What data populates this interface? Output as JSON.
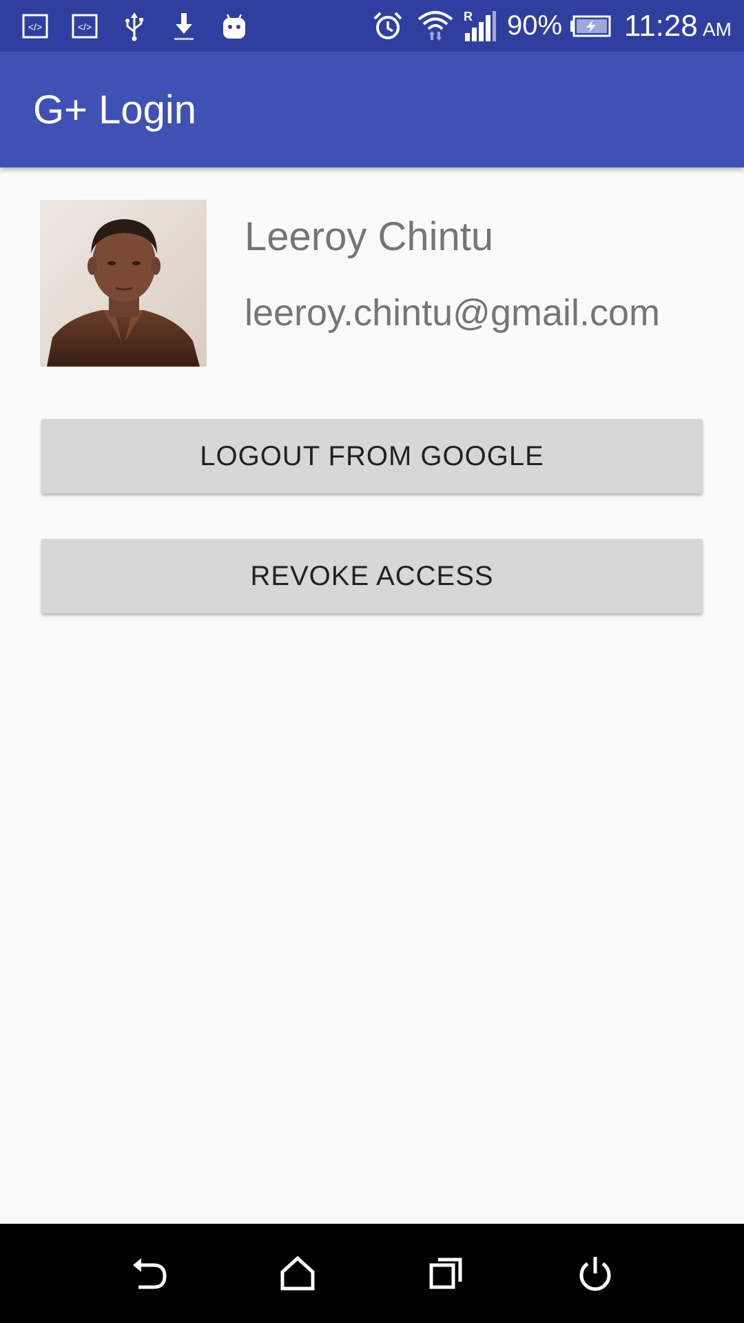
{
  "status_bar": {
    "battery_percent": "90%",
    "time": "11:28",
    "am_pm": "AM",
    "network_label": "R",
    "background_color": "#303f9f",
    "left_icons": [
      "code-icon",
      "code-icon",
      "usb-icon",
      "download-icon",
      "android-icon"
    ],
    "right_icons": [
      "alarm-icon",
      "wifi-icon",
      "signal-icon",
      "battery-charging-icon"
    ]
  },
  "app_bar": {
    "title": "G+ Login",
    "background_color": "#3f51b5"
  },
  "profile": {
    "name": "Leeroy Chintu",
    "email": "leeroy.chintu@gmail.com",
    "avatar_icon": "profile-photo"
  },
  "buttons": {
    "logout_label": "LOGOUT FROM GOOGLE",
    "revoke_label": "REVOKE ACCESS"
  },
  "nav_bar": {
    "icons": [
      "back-icon",
      "home-icon",
      "recents-icon",
      "power-icon"
    ]
  }
}
